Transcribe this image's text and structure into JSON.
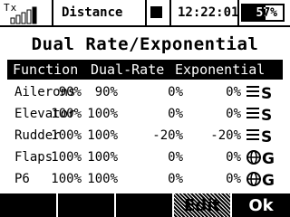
{
  "status": {
    "tx_label": "Tx",
    "model_name": "Distance",
    "clock": "12:22:01",
    "battery_text": "57%",
    "battery_level": 0.57
  },
  "title": "Dual Rate/Exponential",
  "table": {
    "headers": [
      "Function",
      "Dual-Rate",
      "Exponential"
    ],
    "rows": [
      {
        "function": "Ailerons",
        "dr1": "90%",
        "dr2": "90%",
        "ex1": "0%",
        "ex2": "0%",
        "icon": "switch-s-icon"
      },
      {
        "function": "Elevator",
        "dr1": "100%",
        "dr2": "100%",
        "ex1": "0%",
        "ex2": "0%",
        "icon": "switch-s-icon"
      },
      {
        "function": "Rudder",
        "dr1": "100%",
        "dr2": "100%",
        "ex1": "-20%",
        "ex2": "-20%",
        "icon": "switch-s-icon"
      },
      {
        "function": "Flaps",
        "dr1": "100%",
        "dr2": "100%",
        "ex1": "0%",
        "ex2": "0%",
        "icon": "global-g-icon"
      },
      {
        "function": "P6",
        "dr1": "100%",
        "dr2": "100%",
        "ex1": "0%",
        "ex2": "0%",
        "icon": "global-g-icon"
      }
    ]
  },
  "softkeys": {
    "f1": "",
    "f2": "",
    "f3": "",
    "f4": "Edit",
    "f5": "Ok"
  }
}
